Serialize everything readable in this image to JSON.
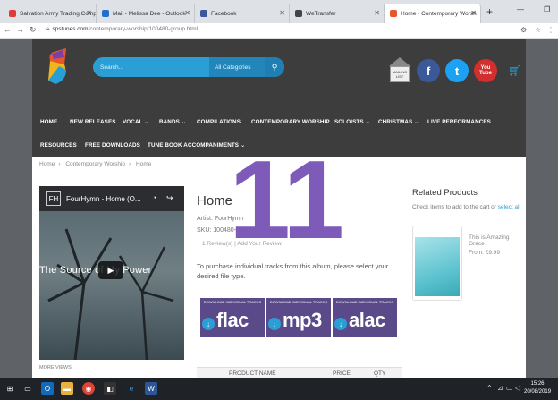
{
  "browser": {
    "tabs": [
      {
        "label": "Salvation Army Trading Comp",
        "color": "#e03a3a"
      },
      {
        "label": "Mail - Melissa Dee - Outlook",
        "color": "#1e6fcf"
      },
      {
        "label": "Facebook",
        "color": "#3b5998"
      },
      {
        "label": "WeTransfer",
        "color": "#444444"
      },
      {
        "label": "Home - Contemporary Worsh",
        "color": "#e8572a"
      }
    ],
    "new_tab": "+",
    "url_host": "spstunes.com",
    "url_path": "/contemporary-worship/100480-group.html"
  },
  "site": {
    "search": {
      "placeholder": "Search...",
      "category": "All Categories"
    },
    "mailing_list": "MAILING LIST",
    "social": {
      "facebook": "f",
      "twitter": "t",
      "youtube": "You Tube"
    },
    "nav_row1": [
      "HOME",
      "NEW RELEASES",
      "VOCAL",
      "BANDS",
      "COMPILATIONS",
      "CONTEMPORARY WORSHIP",
      "SOLOISTS",
      "CHRISTMAS",
      "LIVE PERFORMANCES"
    ],
    "nav_row2": [
      "RESOURCES",
      "FREE DOWNLOADS",
      "TUNE BOOK ACCOMPANIMENTS"
    ],
    "breadcrumb": [
      "Home",
      "Contemporary Worship",
      "Home"
    ],
    "video": {
      "title": "FourHymn - Home (O...",
      "caption": "The Source of My Power",
      "logo": "FH"
    },
    "more_views": "MORE VIEWS",
    "product": {
      "title": "Home",
      "artist": "Artist: FourHymn",
      "sku": "SKU: 100480-group",
      "reviews": "1 Review(s)",
      "add_review": "Add Your Review",
      "instructions": "To purchase individual tracks from this album, please select your desired file type.",
      "download_label": "DOWNLOAD INDIVIDUAL TRACKS",
      "formats": [
        "flac",
        "mp3",
        "alac"
      ]
    },
    "table_headers": {
      "name": "PRODUCT NAME",
      "price": "PRICE",
      "qty": "QTY"
    },
    "related": {
      "title": "Related Products",
      "subtitle_prefix": "Check items to add to the cart or",
      "subtitle_link": "select all",
      "item_name": "This is Amazing Grace",
      "item_price": "From: £9.99"
    }
  },
  "overlay_number": "11",
  "taskbar": {
    "time": "15:26",
    "date": "20/08/2019"
  }
}
